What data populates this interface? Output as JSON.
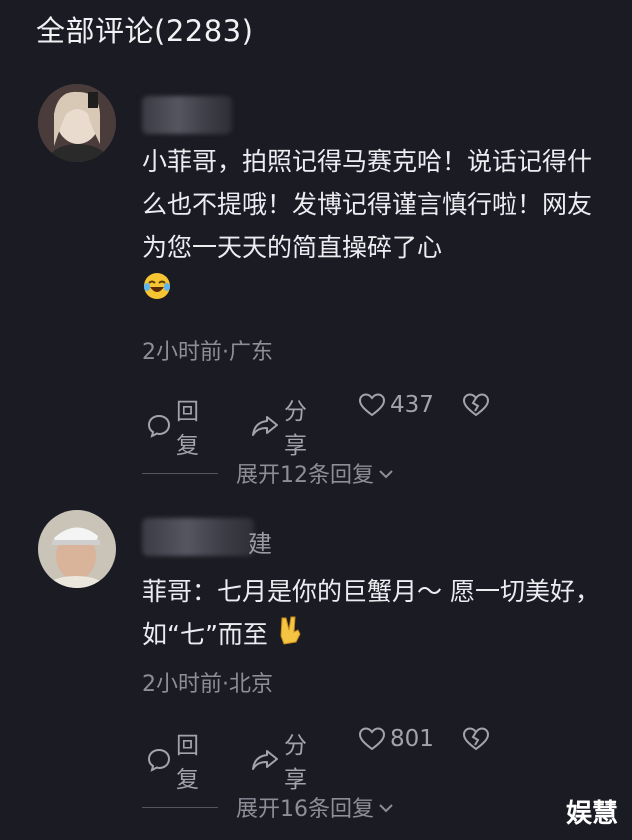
{
  "header": {
    "title": "全部评论(2283)"
  },
  "comments": [
    {
      "username_visible": "",
      "text": "小菲哥，拍照记得马赛克哈！说话记得什么也不提哦！发博记得谨言慎行啦！网友为您一天天的简直操碎了心",
      "meta": "2小时前·广东",
      "reply_label": "回复",
      "share_label": "分享",
      "likes": "437",
      "expand_label": "展开12条回复"
    },
    {
      "username_visible": "建",
      "text": "菲哥：七月是你的巨蟹月～ 愿一切美好，如“七”而至",
      "meta": "2小时前·北京",
      "reply_label": "回复",
      "share_label": "分享",
      "likes": "801",
      "expand_label": "展开16条回复"
    }
  ],
  "watermark": "娱慧",
  "colors": {
    "background": "#1b1b23",
    "text": "#ececf1",
    "muted": "#8e8e99"
  },
  "icons": [
    "reply-icon",
    "share-icon",
    "heart-icon",
    "broken-heart-icon",
    "chevron-down-icon",
    "laugh-emoji-icon",
    "victory-hand-emoji-icon"
  ]
}
